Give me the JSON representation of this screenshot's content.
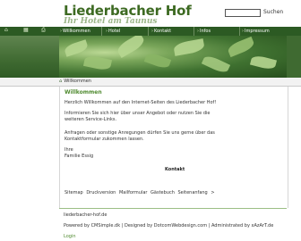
{
  "header": {
    "title": "Liederbacher Hof",
    "subtitle": "Ihr Hotel am Taunus",
    "search": {
      "placeholder": "",
      "button_label": "Suchen"
    }
  },
  "nav": {
    "icons": [
      "home-icon",
      "sitemap-icon",
      "print-icon"
    ],
    "items": [
      {
        "label": "Willkommen"
      },
      {
        "label": "Hotel"
      },
      {
        "label": "Kontakt"
      },
      {
        "label": "Infos"
      },
      {
        "label": "Impressum"
      }
    ]
  },
  "breadcrumb": {
    "label": "Willkommen"
  },
  "main": {
    "heading": "Willkommen",
    "p1": "Herzlich Willkommen auf den Internet-Seiten des Liederbacher Hof!",
    "p2_line1": "Informieren Sie sich hier über unser Angebot oder nutzen Sie die",
    "p2_line2": "weiteren Service-Links.",
    "p3_line1": "Anfragen oder sonstige Anregungen dürfen Sie uns gerne über das",
    "p3_line2": "Kontaktformular zukommen lassen.",
    "sign1": "Ihre",
    "sign2": "Familie Essig",
    "kontakt": "Kontakt",
    "links": [
      "Sitemap",
      "Druckversion",
      "Mailformular",
      "Gästebuch",
      "Seitenanfang",
      ">"
    ]
  },
  "footer": {
    "domain": "liederbacher-hof.de",
    "credits": "Powered by CMSimple.dk | Designed by DotcomWebdesign.com | Administrated by xAzArT.de",
    "login": "Login"
  },
  "colors": {
    "brand_green": "#3d6a22",
    "nav_green": "#2c5a23",
    "accent_green": "#4f8a2f"
  }
}
